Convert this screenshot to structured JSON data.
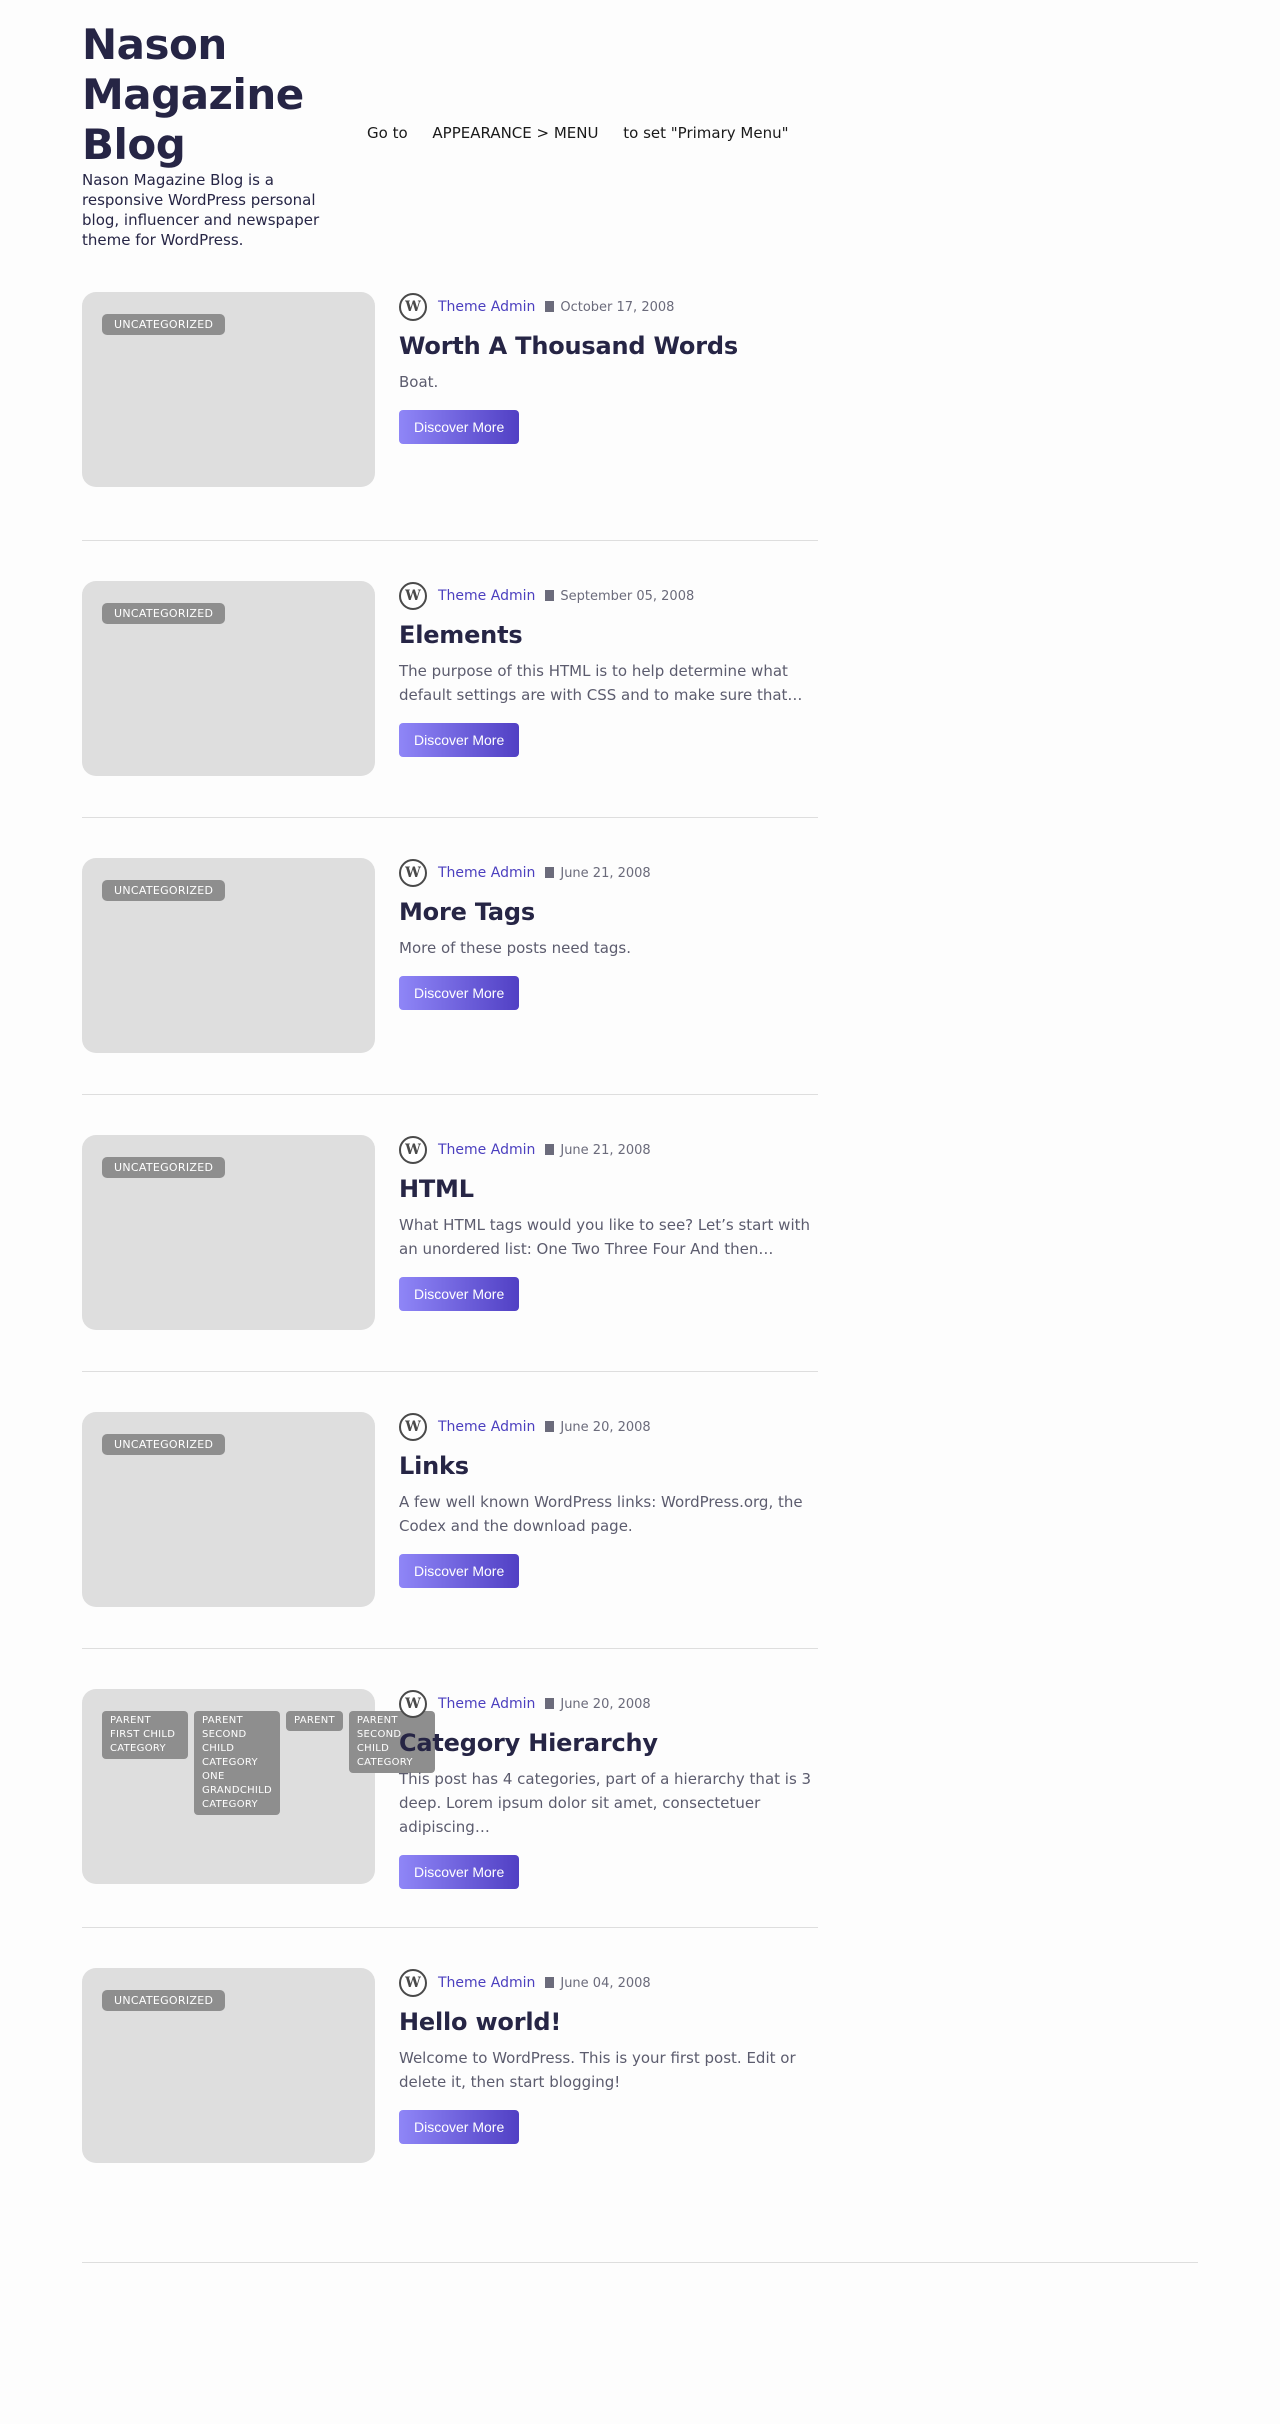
{
  "site": {
    "title": "Nason Magazine Blog",
    "description": "Nason Magazine Blog is a responsive WordPress personal blog, influencer and newspaper theme for WordPress."
  },
  "menu_notice": {
    "prefix": "Go to",
    "path": "APPEARANCE > MENU",
    "suffix": "to set \"Primary Menu\""
  },
  "icons": {
    "avatar": "wordpress-logo-icon",
    "date": "calendar-icon"
  },
  "colors": {
    "author": "#4b3fbf",
    "button_start": "#8f86f7",
    "button_end": "#5140c4",
    "badge": "#8e8e8e",
    "thumbnail": "#dedede"
  },
  "posts": [
    {
      "categories": [
        "UNCATEGORIZED"
      ],
      "author": "Theme Admin",
      "date": "October 17, 2008",
      "title": "Worth A Thousand Words",
      "excerpt": "Boat.",
      "button": "Discover More"
    },
    {
      "categories": [
        "UNCATEGORIZED"
      ],
      "author": "Theme Admin",
      "date": "September 05, 2008",
      "title": "Elements",
      "excerpt": "The purpose of this HTML is to help determine what default settings are with CSS and to make sure that…",
      "button": "Discover More"
    },
    {
      "categories": [
        "UNCATEGORIZED"
      ],
      "author": "Theme Admin",
      "date": "June 21, 2008",
      "title": "More Tags",
      "excerpt": "More of these posts need tags.",
      "button": "Discover More"
    },
    {
      "categories": [
        "UNCATEGORIZED"
      ],
      "author": "Theme Admin",
      "date": "June 21, 2008",
      "title": "HTML",
      "excerpt": "What HTML tags would you like to see? Let’s start with an unordered list: One Two Three Four And then…",
      "button": "Discover More"
    },
    {
      "categories": [
        "UNCATEGORIZED"
      ],
      "author": "Theme Admin",
      "date": "June 20, 2008",
      "title": "Links",
      "excerpt": "A few well known WordPress links: WordPress.org, the Codex and the download page.",
      "button": "Discover More"
    },
    {
      "categories": [
        "PARENT FIRST CHILD CATEGORY",
        "PARENT SECOND CHILD CATEGORY ONE GRANDCHILD CATEGORY",
        "PARENT",
        "PARENT SECOND CHILD CATEGORY"
      ],
      "author": "Theme Admin",
      "date": "June 20, 2008",
      "title": "Category Hierarchy",
      "excerpt": "This post has 4 categories, part of a hierarchy that is 3 deep. Lorem ipsum dolor sit amet, consectetuer adipiscing…",
      "button": "Discover More"
    },
    {
      "categories": [
        "UNCATEGORIZED"
      ],
      "author": "Theme Admin",
      "date": "June 04, 2008",
      "title": "Hello world!",
      "excerpt": "Welcome to WordPress. This is your first post. Edit or delete it, then start blogging!",
      "button": "Discover More"
    }
  ]
}
